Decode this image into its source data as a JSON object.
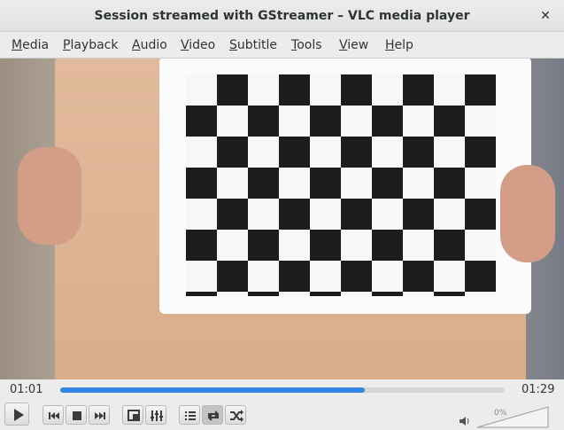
{
  "window": {
    "title": "Session streamed with GStreamer – VLC media player",
    "close_glyph": "✕"
  },
  "menu": [
    "Media",
    "Playback",
    "Audio",
    "Video",
    "Subtitle",
    "Tools",
    "View",
    "Help"
  ],
  "player": {
    "elapsed": "01:01",
    "duration": "01:29",
    "progress": 0.685,
    "volume_label": "0%",
    "volume_level": 0
  },
  "icons": {
    "play": "play-icon",
    "previous": "previous-icon",
    "stop": "stop-icon",
    "next": "next-icon",
    "fullscreen": "fullscreen-icon",
    "extended_settings": "equalizer-icon",
    "playlist": "playlist-icon",
    "loop": "loop-icon",
    "shuffle": "shuffle-icon",
    "volume": "speaker-icon"
  },
  "colors": {
    "progress": "#3584e4",
    "loop_active": "#c4c4c4"
  }
}
